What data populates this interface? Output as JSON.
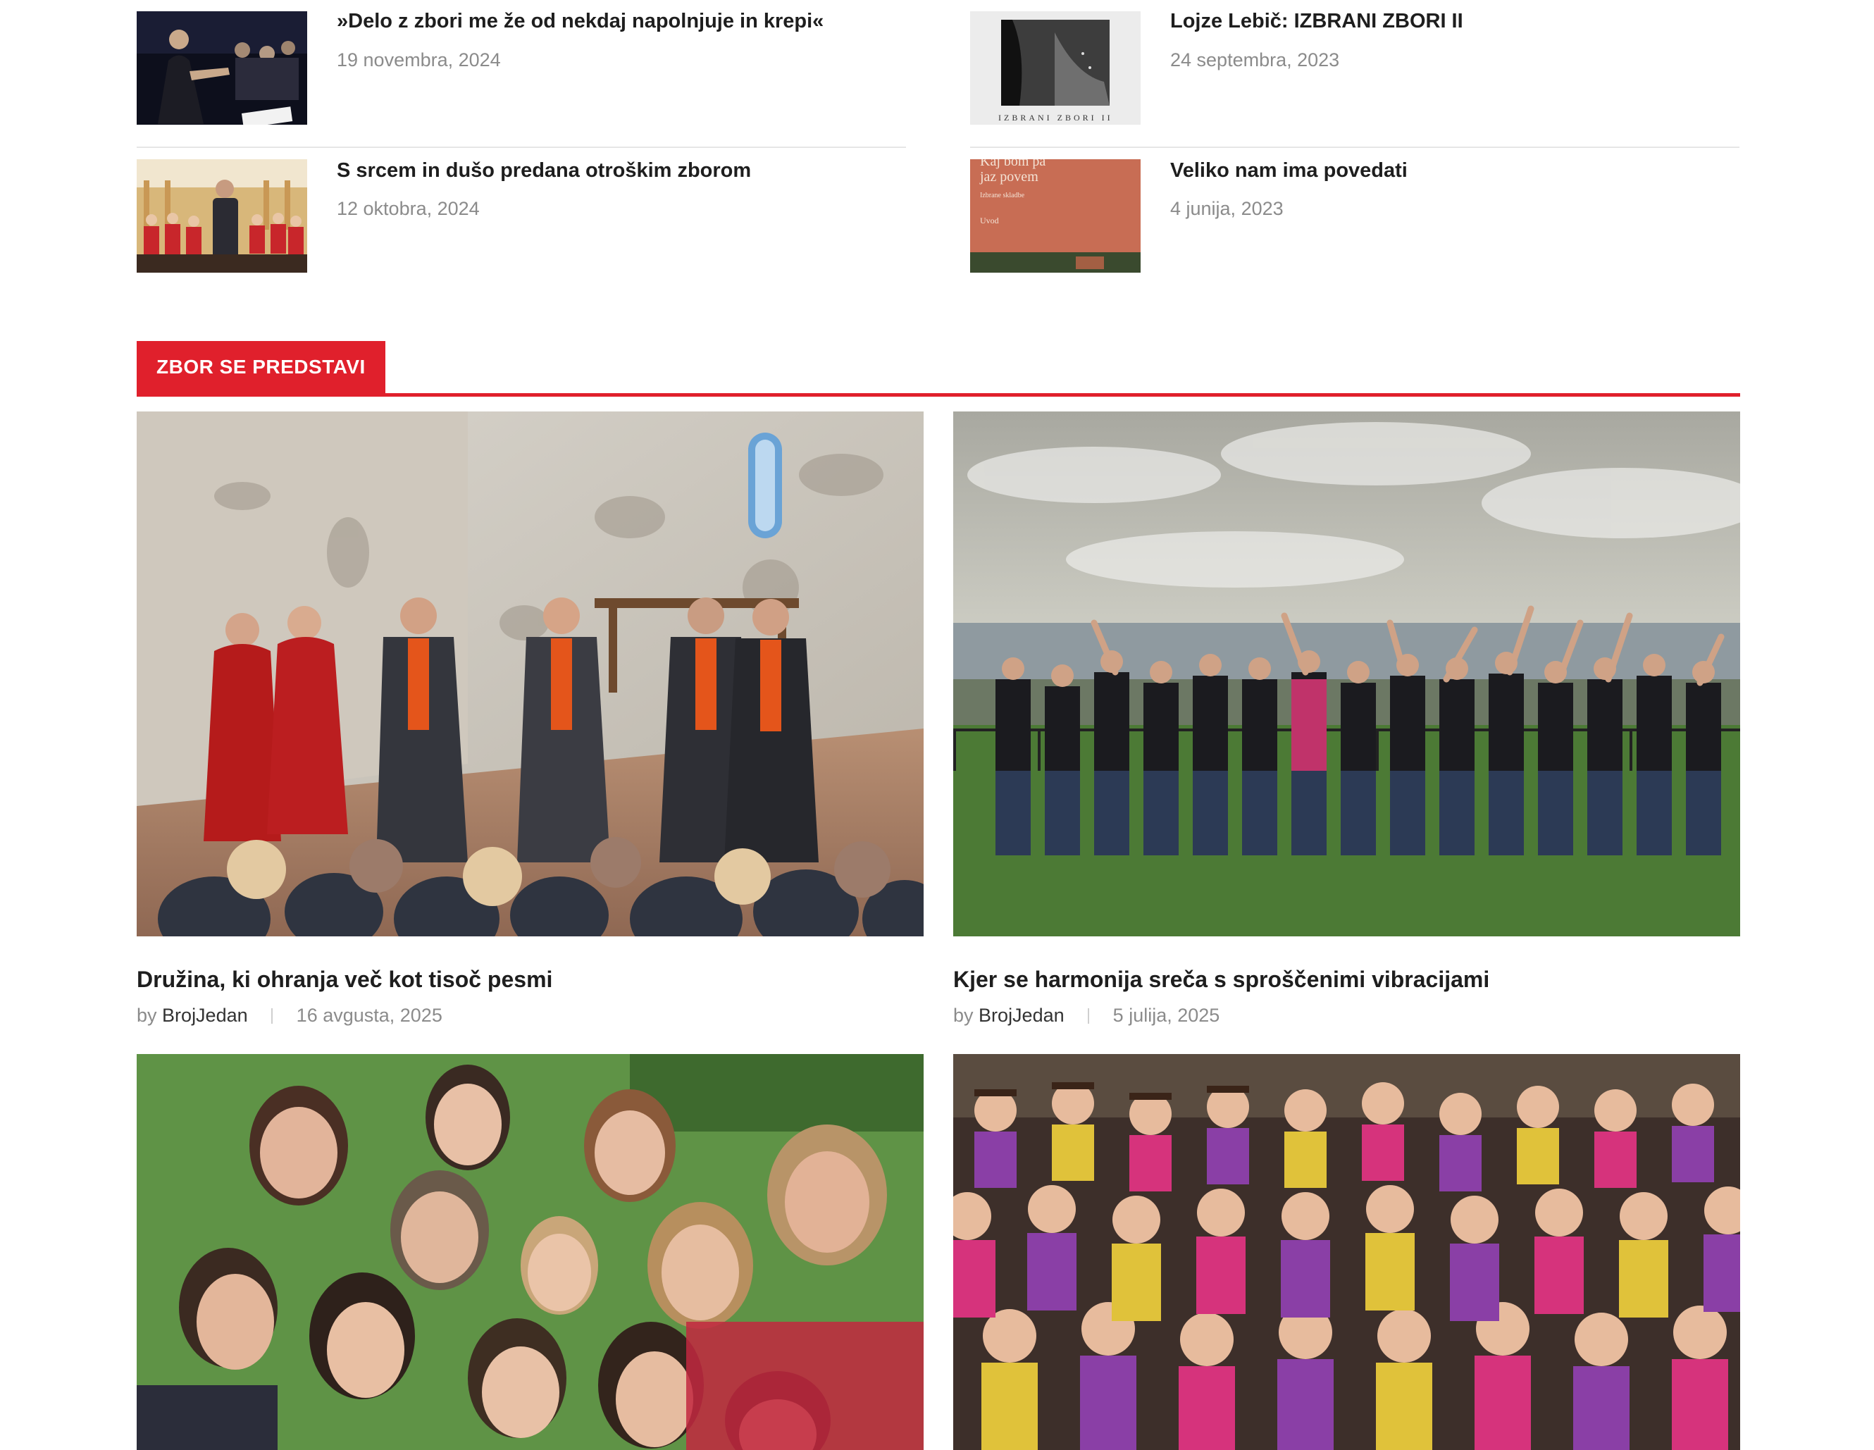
{
  "recent_posts": {
    "left": [
      {
        "title": "»Delo z zbori me že od nekdaj napolnjuje in krepi«",
        "date": "19 novembra, 2024"
      },
      {
        "title": "S srcem in dušo predana otroškim zborom",
        "date": "12 oktobra, 2024"
      }
    ],
    "right": [
      {
        "title": "Lojze Lebič: IZBRANI ZBORI II",
        "date": "24 septembra, 2023",
        "cover_text": "IZBRANI ZBORI II"
      },
      {
        "title": "Veliko nam ima povedati",
        "date": "4 junija, 2023",
        "cover_text_1": "Kaj bom pa",
        "cover_text_2": "jaz povem",
        "cover_text_3": "Izbrane skladbe",
        "cover_text_4": "Uvod"
      }
    ]
  },
  "section": {
    "label": "ZBOR SE PREDSTAVI",
    "accent": "#e0202c"
  },
  "cards": [
    {
      "title": "Družina, ki ohranja več kot tisoč pesmi",
      "by": "by",
      "author": "BrojJedan",
      "date": "16 avgusta, 2025"
    },
    {
      "title": "Kjer se harmonija sreča s sproščenimi vibracijami",
      "by": "by",
      "author": "BrojJedan",
      "date": "5 julija, 2025"
    }
  ]
}
